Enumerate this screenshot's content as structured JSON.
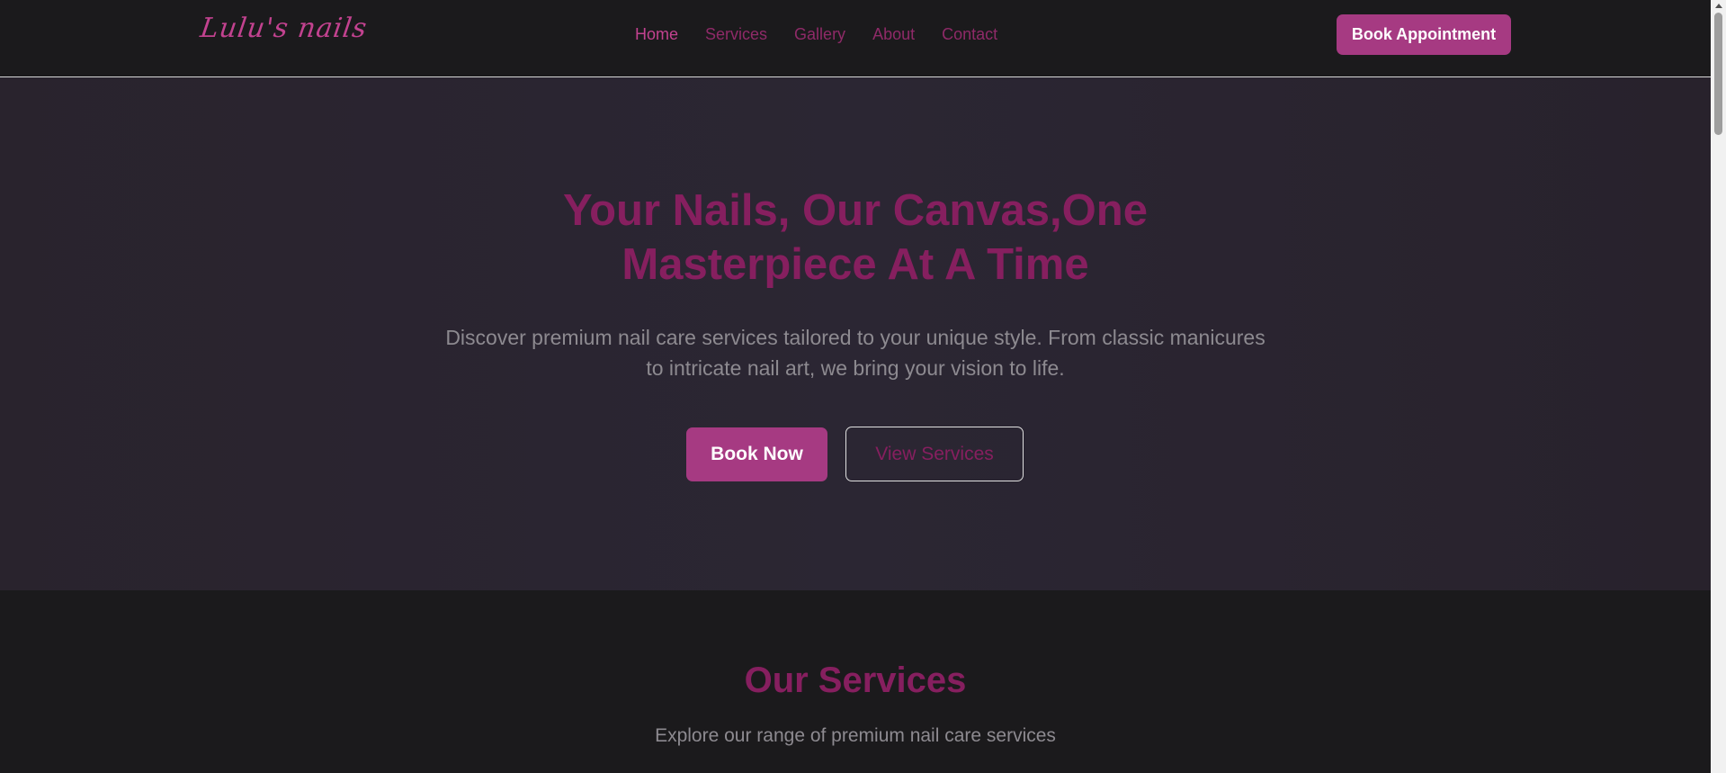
{
  "brand": {
    "logo_text": "Lulu's nails",
    "accent": "#a63a82",
    "heading_color": "#861f5f"
  },
  "nav": {
    "links": [
      {
        "label": "Home",
        "active": true
      },
      {
        "label": "Services",
        "active": false
      },
      {
        "label": "Gallery",
        "active": false
      },
      {
        "label": "About",
        "active": false
      },
      {
        "label": "Contact",
        "active": false
      }
    ],
    "cta_label": "Book Appointment"
  },
  "hero": {
    "title_line1": "Your Nails, Our Canvas,One",
    "title_line2": "Masterpiece At A Time",
    "subtitle_line1": "Discover premium nail care services tailored to your unique style. From classic manicures",
    "subtitle_line2": "to intricate nail art, we bring your vision to life.",
    "primary_button": "Book Now",
    "secondary_button": "View Services"
  },
  "services": {
    "title": "Our Services",
    "subtitle": "Explore our range of premium nail care services"
  }
}
